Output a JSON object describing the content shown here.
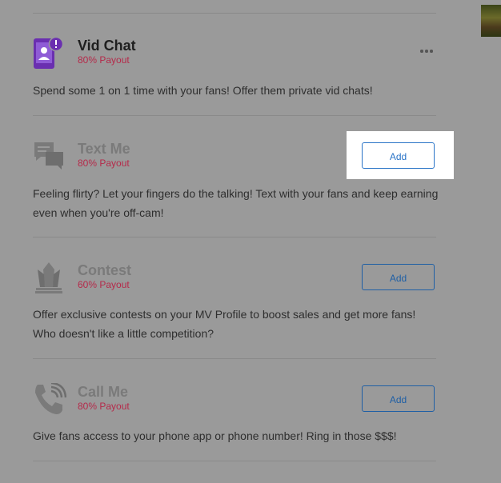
{
  "items": [
    {
      "title": "Vid Chat",
      "payout": "80% Payout",
      "description": "Spend some 1 on 1 time with your fans! Offer them private vid chats!",
      "icon": "vid-chat-icon",
      "action": "more"
    },
    {
      "title": "Text Me",
      "payout": "80% Payout",
      "description": "Feeling flirty? Let your fingers do the talking! Text with your fans and keep earning even when you're off-cam!",
      "icon": "chat-bubbles-icon",
      "action": "Add"
    },
    {
      "title": "Contest",
      "payout": "60% Payout",
      "description": "Offer exclusive contests on your MV Profile to boost sales and get more fans! Who doesn't like a little competition?",
      "icon": "crown-icon",
      "action": "Add"
    },
    {
      "title": "Call Me",
      "payout": "80% Payout",
      "description": "Give fans access to your phone app or phone number! Ring in those $$$!",
      "icon": "phone-icon",
      "action": "Add"
    }
  ],
  "colors": {
    "overlay": "#9a9a9a",
    "payout": "#b52a4a",
    "button": "#1f5fa5",
    "vid_chat_icon": "#6a2fb0"
  }
}
